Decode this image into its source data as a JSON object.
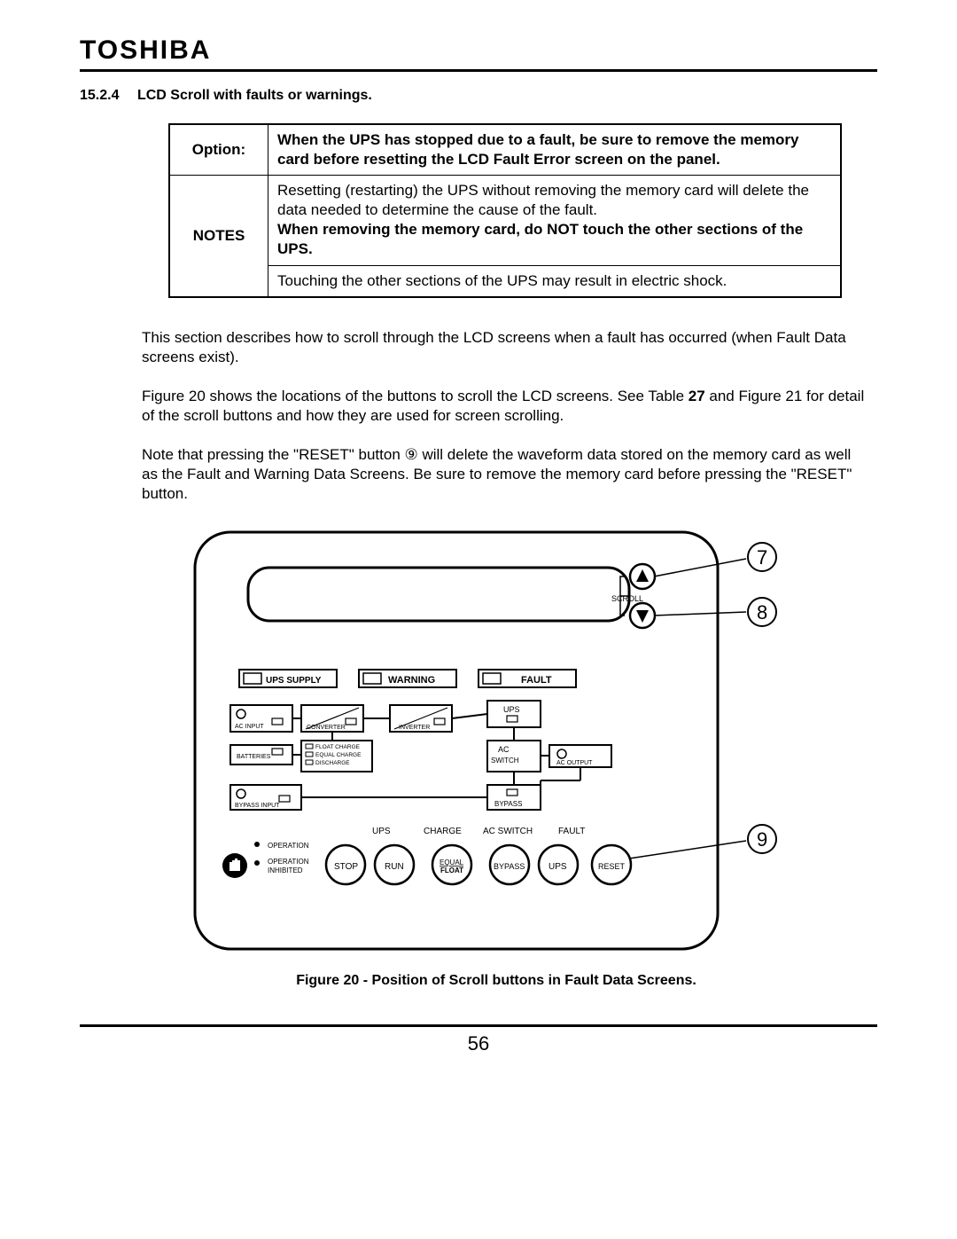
{
  "brand": "TOSHIBA",
  "section": {
    "number": "15.2.4",
    "title": "LCD Scroll with faults or warnings."
  },
  "notes_table": {
    "option_label": "Option:",
    "option_text": "When the UPS has stopped due to a fault, be sure to remove the memory card before resetting the LCD Fault Error screen on the panel.",
    "notes_label": "NOTES",
    "note1_a": "Resetting (restarting) the UPS without removing the memory card will delete the data needed to determine the cause of the fault.",
    "note1_b": "When removing the memory card, do NOT touch the other sections of the UPS.",
    "note2": "Touching the other sections of the UPS may result in electric shock."
  },
  "paragraphs": {
    "p1": "This section describes how to scroll through the LCD screens when a fault has occurred (when Fault Data screens exist).",
    "p2_a": "Figure 20 shows the locations of the buttons to scroll the LCD screens. See Table ",
    "p2_b": "27",
    "p2_c": " and Figure 21 for detail of the scroll buttons and how they are used for screen scrolling.",
    "p3": "Note that pressing the \"RESET\" button ⑨ will delete the waveform data stored on the memory card as well as the Fault and Warning Data Screens. Be sure to remove the memory card before pressing the \"RESET\" button."
  },
  "figure": {
    "caption": "Figure 20 - Position of Scroll buttons in Fault Data Screens.",
    "callouts": {
      "c7": "7",
      "c8": "8",
      "c9": "9"
    },
    "scroll_label": "SCROLL",
    "status_boxes": {
      "ups_supply": "UPS SUPPLY",
      "warning": "WARNING",
      "fault": "FAULT"
    },
    "blocks": {
      "ac_input": "AC INPUT",
      "converter": "CONVERTER",
      "inverter": "INVERTER",
      "ups": "UPS",
      "batteries": "BATTERIES",
      "float_charge": "FLOAT CHARGE",
      "equal_charge": "EQUAL CHARGE",
      "discharge": "DISCHARGE",
      "ac_switch": "AC\nSWITCH",
      "ac_output": "AC OUTPUT",
      "bypass_input": "BYPASS INPUT",
      "bypass": "BYPASS"
    },
    "button_row": {
      "ups": "UPS",
      "charge": "CHARGE",
      "ac_switch": "AC SWITCH",
      "fault": "FAULT",
      "operation": "OPERATION",
      "operation_inhibited_a": "OPERATION",
      "operation_inhibited_b": "INHIBITED",
      "stop": "STOP",
      "run": "RUN",
      "equal": "EQUAL",
      "float": "FLOAT",
      "bypass": "BYPASS",
      "ups_btn": "UPS",
      "reset": "RESET"
    }
  },
  "page_number": "56"
}
